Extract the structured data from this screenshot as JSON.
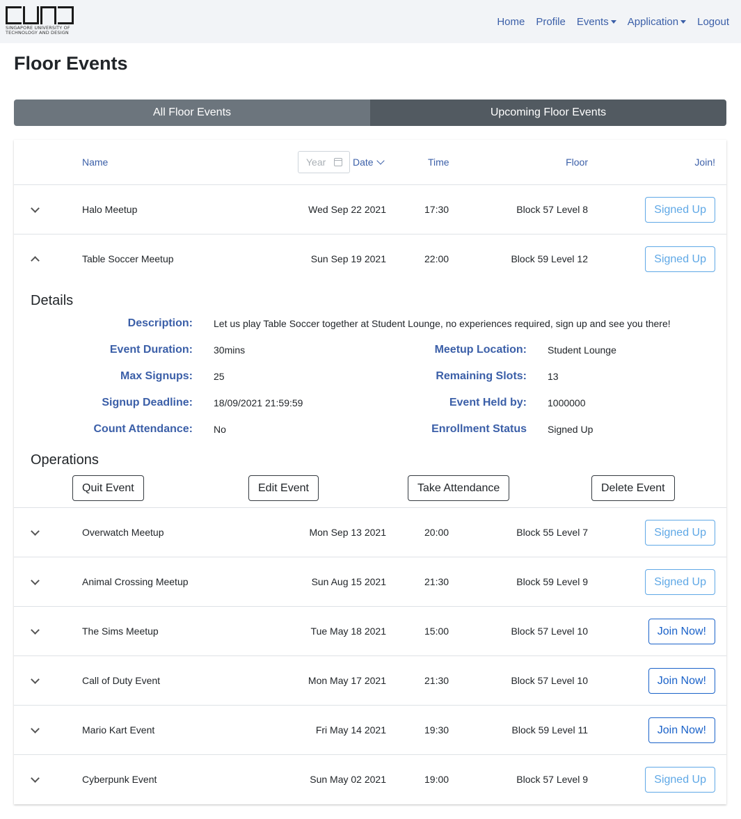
{
  "navbar": {
    "logo_text_line1": "SINGAPORE UNIVERSITY OF",
    "logo_text_line2": "TECHNOLOGY AND DESIGN",
    "items": [
      {
        "label": "Home"
      },
      {
        "label": "Profile"
      },
      {
        "label": "Events"
      },
      {
        "label": "Application"
      },
      {
        "label": "Logout"
      }
    ]
  },
  "page": {
    "title": "Floor Events"
  },
  "tabs": [
    {
      "label": "All Floor Events",
      "active": true
    },
    {
      "label": "Upcoming Floor Events",
      "active": false
    }
  ],
  "table": {
    "headers": {
      "name": "Name",
      "year_placeholder": "Year",
      "date": "Date",
      "time": "Time",
      "floor": "Floor",
      "join": "Join!"
    },
    "rows": [
      {
        "name": "Halo Meetup",
        "date": "Wed Sep 22 2021",
        "time": "17:30",
        "floor": "Block 57 Level 8",
        "action": "Signed Up",
        "expanded": false
      },
      {
        "name": "Table Soccer Meetup",
        "date": "Sun Sep 19 2021",
        "time": "22:00",
        "floor": "Block 59 Level 12",
        "action": "Signed Up",
        "expanded": true
      },
      {
        "name": "Overwatch Meetup",
        "date": "Mon Sep 13 2021",
        "time": "20:00",
        "floor": "Block 55 Level 7",
        "action": "Signed Up",
        "expanded": false
      },
      {
        "name": "Animal Crossing Meetup",
        "date": "Sun Aug 15 2021",
        "time": "21:30",
        "floor": "Block 59 Level 9",
        "action": "Signed Up",
        "expanded": false
      },
      {
        "name": "The Sims Meetup",
        "date": "Tue May 18 2021",
        "time": "15:00",
        "floor": "Block 57 Level 10",
        "action": "Join Now!",
        "expanded": false
      },
      {
        "name": "Call of Duty Event",
        "date": "Mon May 17 2021",
        "time": "21:30",
        "floor": "Block 57 Level 10",
        "action": "Join Now!",
        "expanded": false
      },
      {
        "name": "Mario Kart Event",
        "date": "Fri May 14 2021",
        "time": "19:30",
        "floor": "Block 59 Level 11",
        "action": "Join Now!",
        "expanded": false
      },
      {
        "name": "Cyberpunk Event",
        "date": "Sun May 02 2021",
        "time": "19:00",
        "floor": "Block 57 Level 9",
        "action": "Signed Up",
        "expanded": false
      }
    ]
  },
  "details": {
    "title": "Details",
    "description_label": "Description:",
    "description": "Let us play Table Soccer together at Student Lounge, no experiences required, sign up and see you there!",
    "duration_label": "Event Duration:",
    "duration": "30mins",
    "location_label": "Meetup Location:",
    "location": "Student Lounge",
    "max_label": "Max Signups:",
    "max": "25",
    "remaining_label": "Remaining Slots:",
    "remaining": "13",
    "deadline_label": "Signup Deadline:",
    "deadline": "18/09/2021 21:59:59",
    "held_by_label": "Event Held by:",
    "held_by": "1000000",
    "attendance_label": "Count Attendance:",
    "attendance": "No",
    "status_label": "Enrollment Status",
    "status": "Signed Up"
  },
  "operations": {
    "title": "Operations",
    "quit": "Quit Event",
    "edit": "Edit Event",
    "take_attendance": "Take Attendance",
    "delete": "Delete Event"
  },
  "colors": {
    "link": "#3b5fa8",
    "signed_up": "#5fa8e6",
    "join_now": "#1a62c9",
    "tab_active": "#6c757d",
    "tab_inactive": "#525a61"
  }
}
